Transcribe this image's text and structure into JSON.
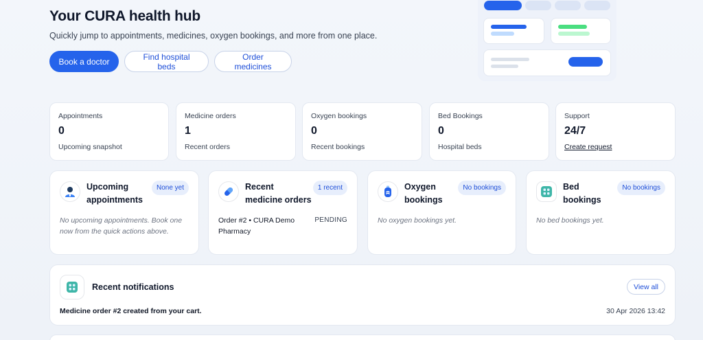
{
  "hero": {
    "title": "Your CURA health hub",
    "subtitle": "Quickly jump to appointments, medicines, oxygen bookings, and more from one place.",
    "actions": {
      "book_doctor": "Book a doctor",
      "find_beds": "Find hospital beds",
      "order_medicines": "Order medicines"
    }
  },
  "stats": [
    {
      "label": "Appointments",
      "value": "0",
      "sub": "Upcoming snapshot"
    },
    {
      "label": "Medicine orders",
      "value": "1",
      "sub": "Recent orders"
    },
    {
      "label": "Oxygen bookings",
      "value": "0",
      "sub": "Recent bookings"
    },
    {
      "label": "Bed Bookings",
      "value": "0",
      "sub": "Hospital beds"
    },
    {
      "label": "Support",
      "value": "24/7",
      "link": "Create request"
    }
  ],
  "sections": {
    "appointments": {
      "title": "Upcoming appointments",
      "badge": "None yet",
      "empty": "No upcoming appointments. Book one now from the quick actions above."
    },
    "medicine_orders": {
      "title": "Recent medicine orders",
      "badge": "1 recent",
      "order": {
        "name": "Order #2 • CURA Demo Pharmacy",
        "status": "PENDING"
      }
    },
    "oxygen": {
      "title": "Oxygen bookings",
      "badge": "No bookings",
      "empty": "No oxygen bookings yet."
    },
    "beds": {
      "title": "Bed bookings",
      "badge": "No bookings",
      "empty": "No bed bookings yet."
    }
  },
  "notifications": {
    "title": "Recent notifications",
    "view_all": "View all",
    "items": [
      {
        "message": "Medicine order #2 created from your cart.",
        "time": "30 Apr 2026 13:42"
      }
    ]
  },
  "colors": {
    "primary": "#2563eb",
    "pill_bg": "#e7eefc",
    "accent_green": "#4ade80",
    "teal": "#3fb6a8"
  },
  "icons": {
    "appointments": "doctor-icon",
    "medicine": "pill-icon",
    "oxygen": "oxygen-cylinder-icon",
    "beds": "bed-grid-icon",
    "notifications": "bell-grid-icon"
  }
}
